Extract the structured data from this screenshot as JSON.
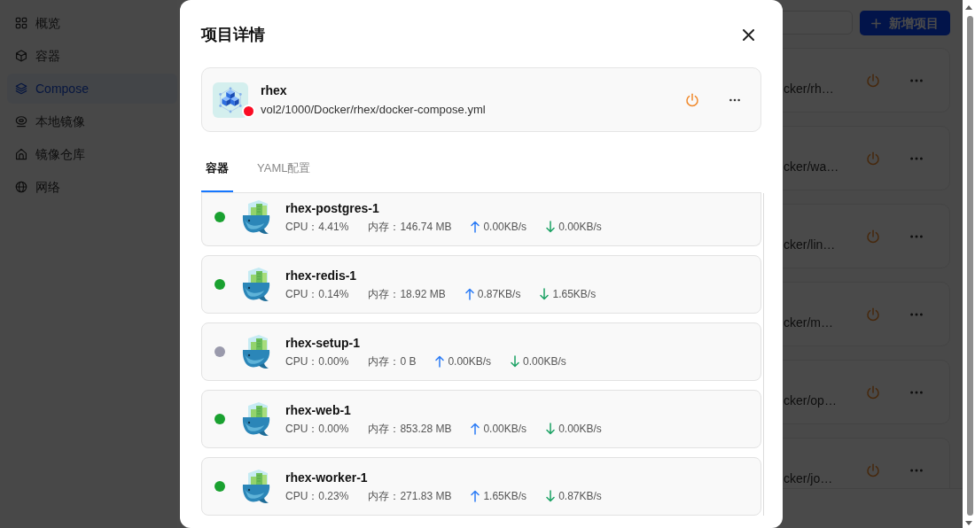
{
  "sidebar": {
    "items": [
      {
        "label": "概览",
        "selected": false
      },
      {
        "label": "容器",
        "selected": false
      },
      {
        "label": "Compose",
        "selected": true
      },
      {
        "label": "本地镜像",
        "selected": false
      },
      {
        "label": "镜像仓库",
        "selected": false
      },
      {
        "label": "网络",
        "selected": false
      }
    ]
  },
  "toolbar": {
    "add_button": "新增项目"
  },
  "projects": [
    {
      "path": "cker/rh…"
    },
    {
      "path": "cker/wa…"
    },
    {
      "path": "cker/lin…"
    },
    {
      "path": "cker/m…"
    },
    {
      "path": "cker/op…"
    },
    {
      "path": "cker/jo…"
    }
  ],
  "dialog": {
    "title": "项目详情",
    "project": {
      "name": "rhex",
      "path": "vol2/1000/Docker/rhex/docker-compose.yml",
      "color": "#fa0d24"
    },
    "tabs": [
      {
        "label": "容器",
        "selected": true
      },
      {
        "label": "YAML配置",
        "selected": false
      }
    ],
    "containers": [
      {
        "name": "rhex-postgres-1",
        "color": "#1aa130",
        "cpu": "CPU：4.41%",
        "memory": "内存：146.74 MB",
        "upload": "0.00KB/s",
        "download": "0.00KB/s"
      },
      {
        "name": "rhex-redis-1",
        "color": "#1aa130",
        "cpu": "CPU：0.14%",
        "memory": "内存：18.92 MB",
        "upload": "0.87KB/s",
        "download": "1.65KB/s"
      },
      {
        "name": "rhex-setup-1",
        "color": "#9a9aac",
        "cpu": "CPU：0.00%",
        "memory": "内存：0 B",
        "upload": "0.00KB/s",
        "download": "0.00KB/s"
      },
      {
        "name": "rhex-web-1",
        "color": "#1aa130",
        "cpu": "CPU：0.00%",
        "memory": "内存：853.28 MB",
        "upload": "0.00KB/s",
        "download": "0.00KB/s"
      },
      {
        "name": "rhex-worker-1",
        "color": "#1aa130",
        "cpu": "CPU：0.23%",
        "memory": "内存：271.83 MB",
        "upload": "1.65KB/s",
        "download": "0.87KB/s"
      }
    ]
  }
}
